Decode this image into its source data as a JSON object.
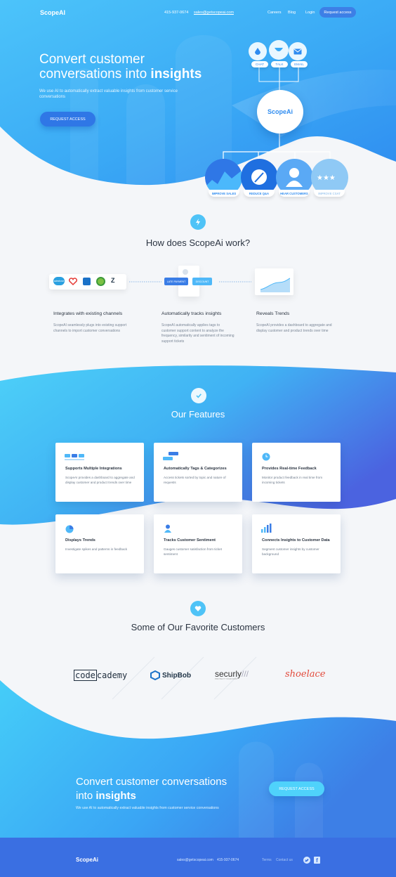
{
  "nav": {
    "logo": "ScopeAI",
    "phone": "415-937-0674",
    "email": "sales@getscopeai.com",
    "careers": "Careers",
    "blog": "Blog",
    "login": "Login",
    "request": "Request access"
  },
  "hero": {
    "title_line1": "Convert customer",
    "title_line2_a": "conversations into ",
    "title_line2_b": "insights",
    "subtitle": "We use AI to automatically extract valuable insights from customer service conversations",
    "cta": "REQUEST ACCESS",
    "channels": [
      "CHAT",
      "TALK",
      "EMAIL"
    ],
    "center_logo": "ScopeAi",
    "outcomes": [
      "IMPROVE SALES",
      "REDUCE Q&A",
      "HEAR CUSTOMERS",
      "IMPROVE CSAT"
    ]
  },
  "how": {
    "title": "How does ScopeAi work?",
    "steps": [
      {
        "title": "Integrates with existing channels",
        "desc": "ScopeAI seamlessly plugs into existing support channels to import customer conversations"
      },
      {
        "title": "Automatically tracks insights",
        "desc": "ScopeAI automatically applies tags to customer support content to analyze the frequency, similarity and sentiment of incoming support tickets"
      },
      {
        "title": "Reveals Trends",
        "desc": "ScopeAI provides a dashboard to aggregate and display customer and product trends over time"
      }
    ],
    "tag_labels": [
      "LATE PAYMENT",
      "DISCOUNT"
    ],
    "integration_names": [
      "salesforce"
    ]
  },
  "features": {
    "title": "Our Features",
    "cards": [
      {
        "title": "Supports Multiple Integrations",
        "desc": "ScopeAI provides a dashboard to aggregate and display customer and product trends over time",
        "icon": "integrations-icon"
      },
      {
        "title": "Automatically Tags & Categorizes",
        "desc": "Access tickets sorted by topic and nature of requests",
        "icon": "tags-icon"
      },
      {
        "title": "Provides Real-time Feedback",
        "desc": "Monitor product feedback in real time from incoming tickets",
        "icon": "clock-icon"
      },
      {
        "title": "Displays Trends",
        "desc": "Investigate spikes and patterns in feedback",
        "icon": "pie-chart-icon"
      },
      {
        "title": "Tracks Customer Sentiment",
        "desc": "Gauges customer satisfaction from ticket sentiment",
        "icon": "user-icon"
      },
      {
        "title": "Connects Insights to Customer Data",
        "desc": "Segment customer insights by customer background",
        "icon": "bar-chart-icon"
      }
    ]
  },
  "customers": {
    "title": "Some of Our Favorite Customers",
    "codecademy_a": "code",
    "codecademy_b": "cademy",
    "shipbob": "ShipBob",
    "securly": "securly",
    "securly_tag": "PROTECT YOUR KIDS",
    "shoelace": "shoelace"
  },
  "cta": {
    "line1": "Convert customer conversations",
    "line2_a": "into ",
    "line2_b": "insights",
    "subtitle": "We use AI to automatically extract valuable insights from customer service conversations",
    "button": "REQUEST ACCESS"
  },
  "footer": {
    "logo": "ScopeAi",
    "email": "sales@getscopeai.com",
    "phone": "415-937-0674",
    "terms": "Terms",
    "contact": "Contact us"
  },
  "colors": {
    "primary": "#2f8cf0",
    "cyan": "#4fc3f7",
    "deep": "#3d6fe0",
    "text": "#2b3441"
  }
}
